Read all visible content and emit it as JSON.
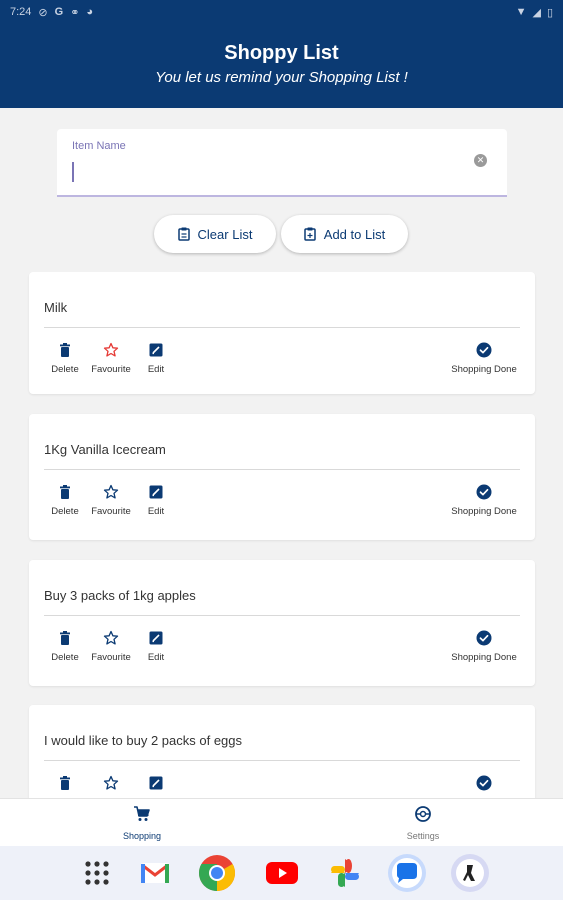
{
  "status_bar": {
    "time": "7:24"
  },
  "header": {
    "title": "Shoppy List",
    "subtitle": "You let us remind your Shopping List !"
  },
  "input": {
    "label": "Item Name",
    "value": "",
    "placeholder": ""
  },
  "buttons": {
    "clear_label": "Clear List",
    "add_label": "Add to List"
  },
  "action_labels": {
    "delete": "Delete",
    "favourite": "Favourite",
    "edit": "Edit",
    "done": "Shopping Done"
  },
  "items": [
    {
      "text": "Milk",
      "favourite": true
    },
    {
      "text": "1Kg Vanilla Icecream",
      "favourite": false
    },
    {
      "text": "Buy 3 packs of 1kg apples",
      "favourite": false
    },
    {
      "text": "I would like to buy 2 packs of eggs",
      "favourite": false
    }
  ],
  "bottom_nav": {
    "shopping_label": "Shopping",
    "settings_label": "Settings"
  },
  "colors": {
    "primary": "#0b3a73",
    "favourite_active": "#e53935",
    "accent_label": "#7a74b5"
  },
  "dock_apps": [
    "app-drawer-icon",
    "gmail-icon",
    "chrome-icon",
    "youtube-icon",
    "photos-icon",
    "messages-icon",
    "app-icon"
  ]
}
